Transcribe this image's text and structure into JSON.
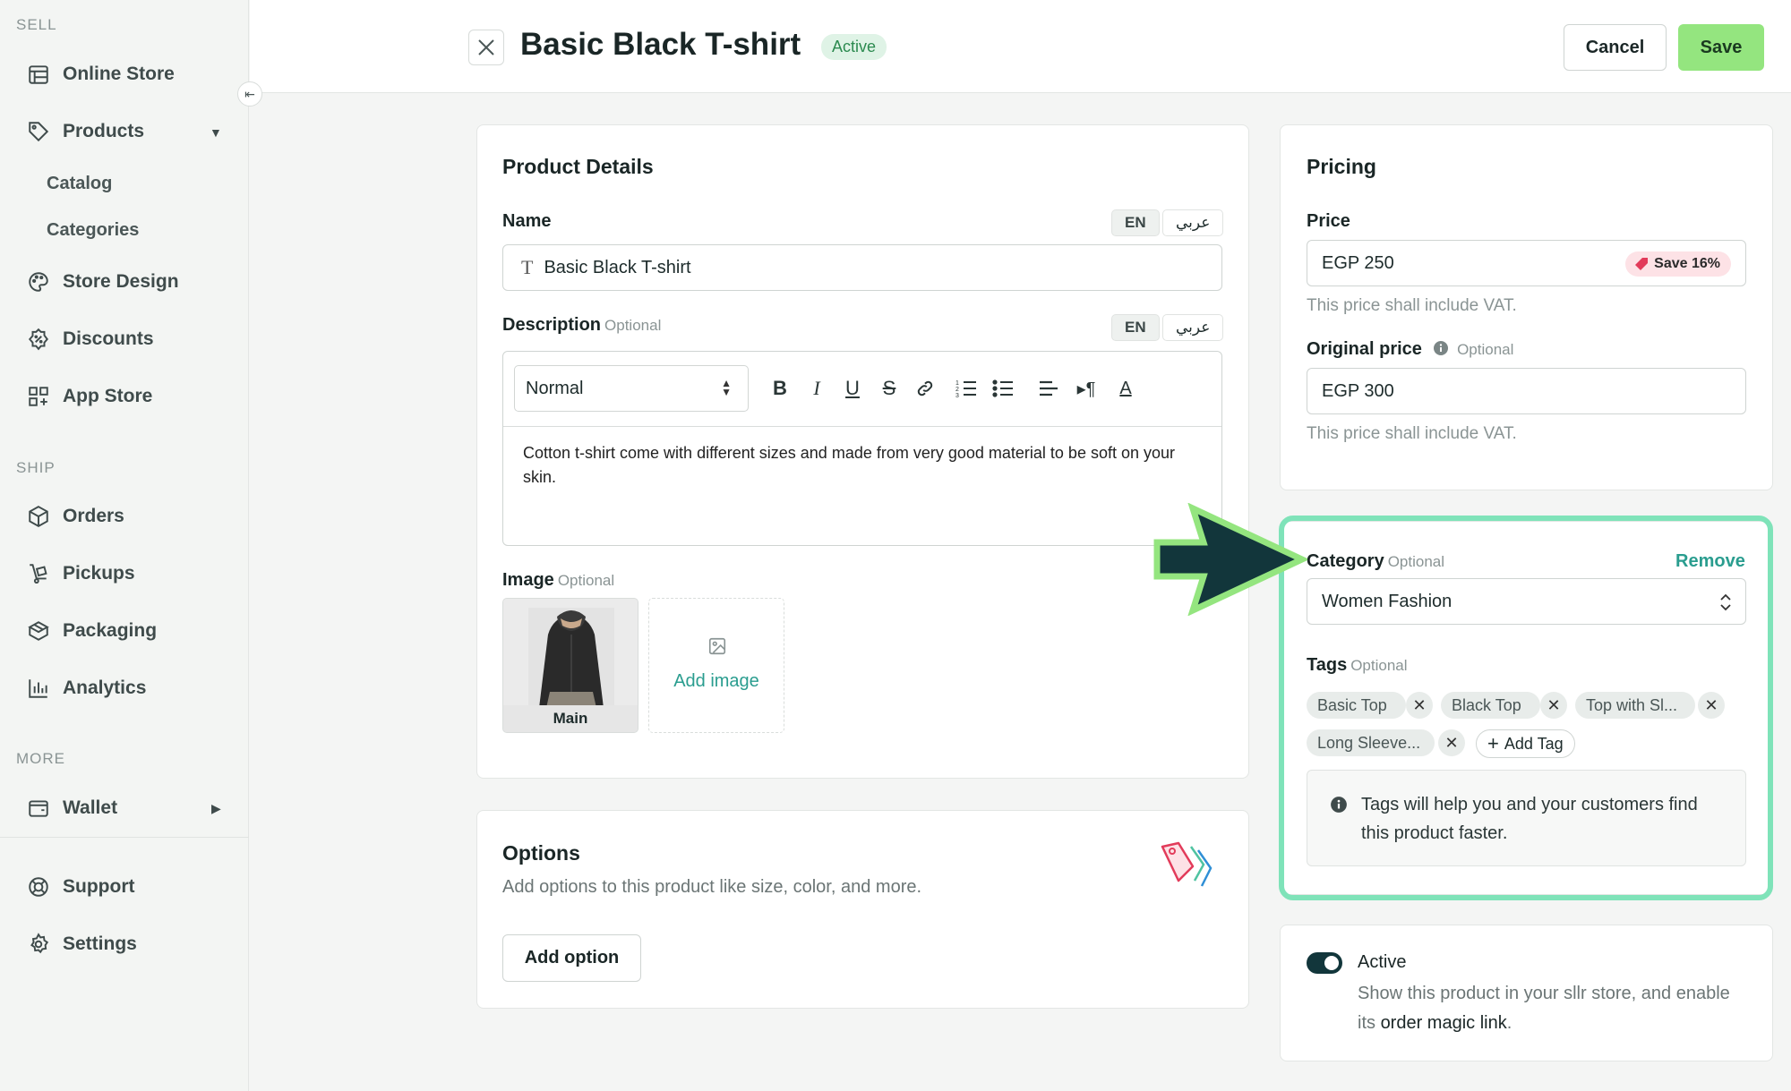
{
  "sidebar": {
    "sections": {
      "sell": "SELL",
      "ship": "SHIP",
      "more": "MORE"
    },
    "items": {
      "online_store": "Online Store",
      "products": "Products",
      "catalog": "Catalog",
      "categories": "Categories",
      "store_design": "Store Design",
      "discounts": "Discounts",
      "app_store": "App Store",
      "orders": "Orders",
      "pickups": "Pickups",
      "packaging": "Packaging",
      "analytics": "Analytics",
      "wallet": "Wallet",
      "support": "Support",
      "settings": "Settings"
    }
  },
  "header": {
    "title": "Basic Black T-shirt",
    "status": "Active",
    "cancel_label": "Cancel",
    "save_label": "Save"
  },
  "product_details": {
    "title": "Product Details",
    "name_label": "Name",
    "name_value": "Basic Black T-shirt",
    "lang_en": "EN",
    "lang_ar": "عربي",
    "description_label": "Description",
    "optional": "Optional",
    "format_value": "Normal",
    "description_text": "Cotton t-shirt come with different sizes and made from very good material to be soft on your skin.",
    "image_label": "Image",
    "image_caption": "Main",
    "add_image_label": "Add image"
  },
  "options": {
    "title": "Options",
    "subtitle": "Add options to this product like size, color, and more.",
    "add_option_label": "Add option"
  },
  "pricing": {
    "title": "Pricing",
    "price_label": "Price",
    "price_value": "EGP 250",
    "save_badge": "Save 16%",
    "vat_note": "This price shall include VAT.",
    "original_price_label": "Original price",
    "original_price_value": "EGP 300",
    "vat_note_2": "This price shall include VAT."
  },
  "category": {
    "label": "Category",
    "optional": "Optional",
    "remove_label": "Remove",
    "value": "Women Fashion"
  },
  "tags": {
    "label": "Tags",
    "optional": "Optional",
    "items": [
      "Basic Top",
      "Black Top",
      "Top with Sl...",
      "Long Sleeve..."
    ],
    "add_tag_label": "Add Tag",
    "info_text": "Tags will help you and your customers find this product faster."
  },
  "active_card": {
    "label": "Active",
    "description": "Show this product in your sllr store, and enable its",
    "link_text": "order magic link",
    "suffix": "."
  },
  "colors": {
    "accent_green": "#94e57f",
    "highlight": "#7fe3b9",
    "arrow_fill": "#12363b",
    "link_teal": "#2a9d8f"
  }
}
